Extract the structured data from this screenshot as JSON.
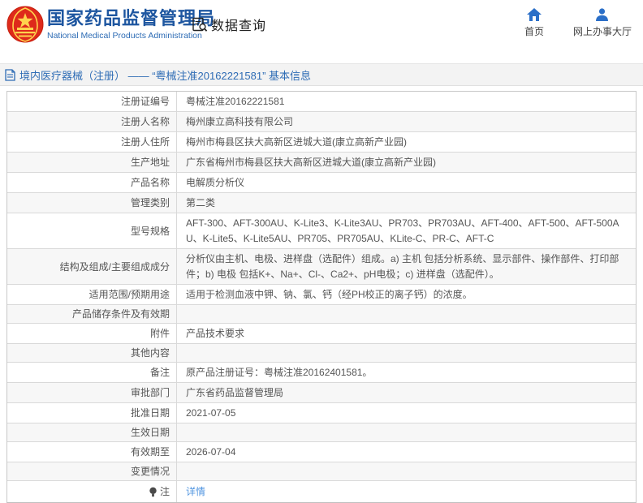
{
  "colors": {
    "brand_blue": "#1e56a0",
    "link_blue": "#5095e0",
    "nav_icon_blue": "#2b6fc8",
    "crumb_blue": "#2e6cb5",
    "stripe_gray": "#f7f7f7",
    "emblem_red": "#de2a1b",
    "emblem_gold": "#ffd34d"
  },
  "header": {
    "org_name_cn": "国家药品监督管理局",
    "org_name_en": "National Medical Products Administration",
    "section_title": "数据查询",
    "nav": [
      {
        "label": "首页",
        "icon": "home-icon"
      },
      {
        "label": "网上办事大厅",
        "icon": "person-icon"
      }
    ]
  },
  "breadcrumb": {
    "text": "境内医疗器械（注册） —— “粤械注准20162221581” 基本信息"
  },
  "table": {
    "rows": [
      {
        "label": "注册证编号",
        "value": "粤械注准20162221581"
      },
      {
        "label": "注册人名称",
        "value": "梅州康立高科技有限公司"
      },
      {
        "label": "注册人住所",
        "value": "梅州市梅县区扶大高新区进城大道(康立高新产业园)"
      },
      {
        "label": "生产地址",
        "value": "广东省梅州市梅县区扶大高新区进城大道(康立高新产业园)"
      },
      {
        "label": "产品名称",
        "value": "电解质分析仪"
      },
      {
        "label": "管理类别",
        "value": "第二类"
      },
      {
        "label": "型号规格",
        "value": "AFT-300、AFT-300AU、K-Lite3、K-Lite3AU、PR703、PR703AU、AFT-400、AFT-500、AFT-500AU、K-Lite5、K-Lite5AU、PR705、PR705AU、KLite-C、PR-C、AFT-C"
      },
      {
        "label": "结构及组成/主要组成成分",
        "value": "分析仪由主机、电极、进样盘（选配件）组成。a) 主机 包括分析系统、显示部件、操作部件、打印部件；b) 电极 包括K+、Na+、Cl-、Ca2+、pH电极；c) 进样盘（选配件）。"
      },
      {
        "label": "适用范围/预期用途",
        "value": "适用于检测血液中钾、钠、氯、钙（经PH校正的离子钙）的浓度。"
      },
      {
        "label": "产品储存条件及有效期",
        "value": ""
      },
      {
        "label": "附件",
        "value": "产品技术要求"
      },
      {
        "label": "其他内容",
        "value": ""
      },
      {
        "label": "备注",
        "value": "原产品注册证号：粤械注准20162401581。"
      },
      {
        "label": "审批部门",
        "value": "广东省药品监督管理局"
      },
      {
        "label": "批准日期",
        "value": "2021-07-05"
      },
      {
        "label": "生效日期",
        "value": ""
      },
      {
        "label": "有效期至",
        "value": "2026-07-04"
      },
      {
        "label": "变更情况",
        "value": ""
      },
      {
        "label": "注",
        "value": "详情",
        "label_icon": "note-icon",
        "value_is_link": true
      }
    ]
  }
}
